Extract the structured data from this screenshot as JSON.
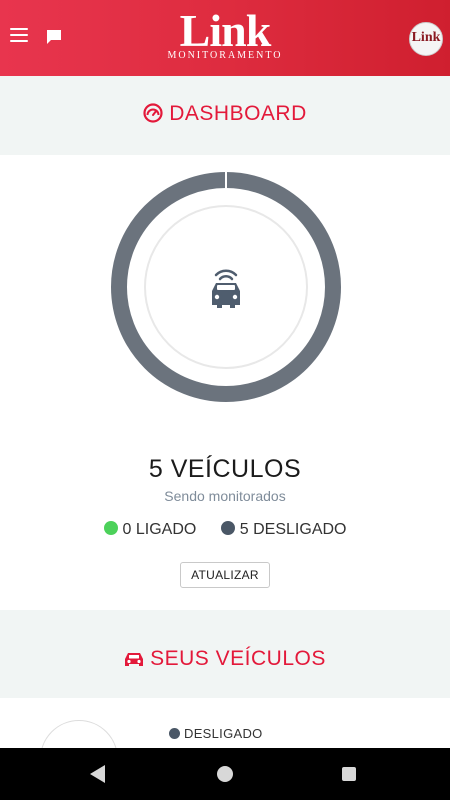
{
  "app": {
    "logo_title": "Link",
    "logo_subtitle": "MONITORAMENTO",
    "avatar_text": "Link"
  },
  "icons": {
    "menu": "hamburger-menu-icon",
    "chat": "chat-bubble-icon",
    "dashboard": "speedometer-icon",
    "center": "car-signal-icon",
    "vehicles": "car-icon"
  },
  "colors": {
    "brand": "#e3193a",
    "ring": "#6b737d",
    "on": "#4cd15a",
    "off": "#4a5766"
  },
  "dashboard": {
    "header": "DASHBOARD",
    "vehicle_count_text": "5 VEÍCULOS",
    "subtitle": "Sendo monitorados",
    "legend_on": "0 LIGADO",
    "legend_off": "5 DESLIGADO",
    "on_count": 0,
    "off_count": 5,
    "refresh_button": "ATUALIZAR"
  },
  "vehicles": {
    "header": "SEUS VEÍCULOS",
    "first_status": "DESLIGADO"
  }
}
